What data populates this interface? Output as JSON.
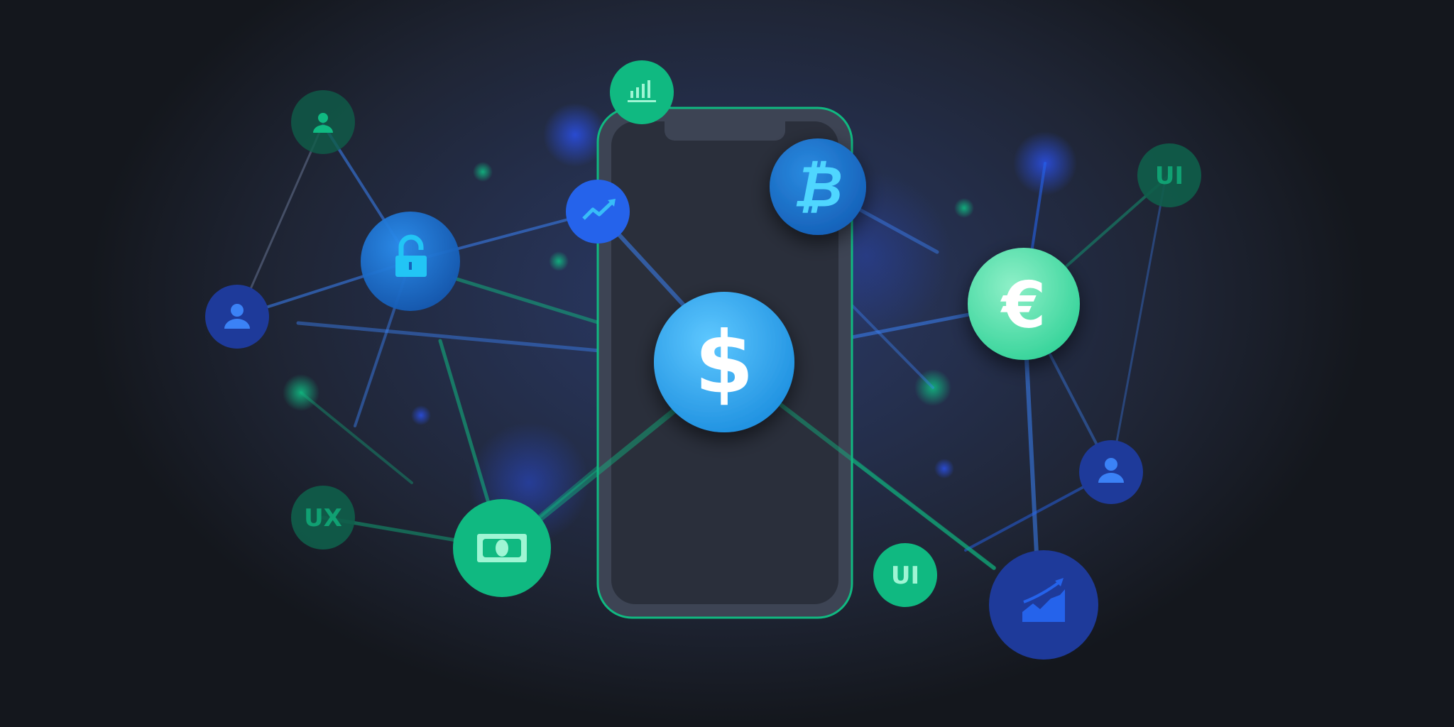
{
  "nodes": {
    "ui_top_right_label": "UI",
    "ux_label": "UX",
    "ui_bottom_label": "UI",
    "currency_symbol_dollar": "$",
    "currency_symbol_euro": "€",
    "currency_symbol_bitcoin": "₿"
  },
  "icons": [
    "user-icon",
    "lock-open-icon",
    "trend-up-icon",
    "bar-chart-icon",
    "bitcoin-icon",
    "dollar-icon",
    "euro-icon",
    "banknote-icon",
    "area-chart-icon"
  ],
  "colors": {
    "green": "#10b981",
    "green_light": "#4ade9e",
    "blue": "#2563eb",
    "cyan": "#38bdf8",
    "navy": "#1e3a8a"
  }
}
